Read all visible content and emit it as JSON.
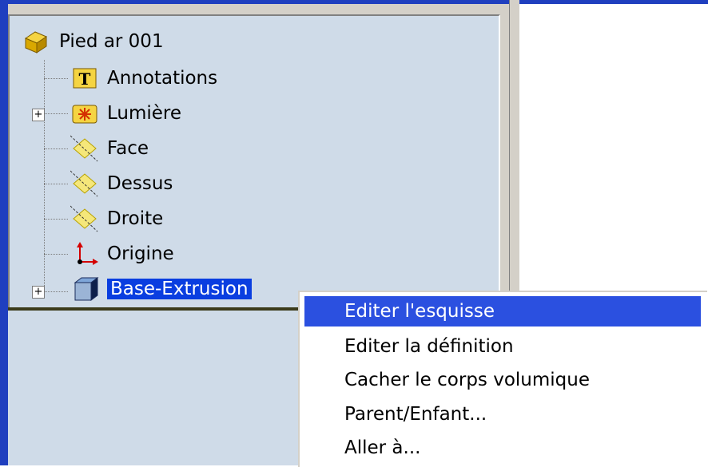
{
  "tree": {
    "root_label": "Pied ar 001",
    "items": [
      {
        "label": "Annotations",
        "icon": "annotations-icon"
      },
      {
        "label": "Lumière",
        "icon": "light-icon"
      },
      {
        "label": "Face",
        "icon": "plane-icon"
      },
      {
        "label": "Dessus",
        "icon": "plane-icon"
      },
      {
        "label": "Droite",
        "icon": "plane-icon"
      },
      {
        "label": "Origine",
        "icon": "origin-icon"
      },
      {
        "label": "Base-Extrusion",
        "icon": "extrusion-icon"
      }
    ]
  },
  "context_menu": {
    "items": [
      {
        "label": "Editer l'esquisse"
      },
      {
        "label": "Editer la définition"
      },
      {
        "label": "Cacher le corps volumique"
      },
      {
        "label": "Parent/Enfant..."
      },
      {
        "label": "Aller à..."
      }
    ]
  },
  "colors": {
    "selection": "#0a3ee0",
    "menu_highlight": "#2b50e0",
    "tree_bg": "#cfdbe8"
  }
}
